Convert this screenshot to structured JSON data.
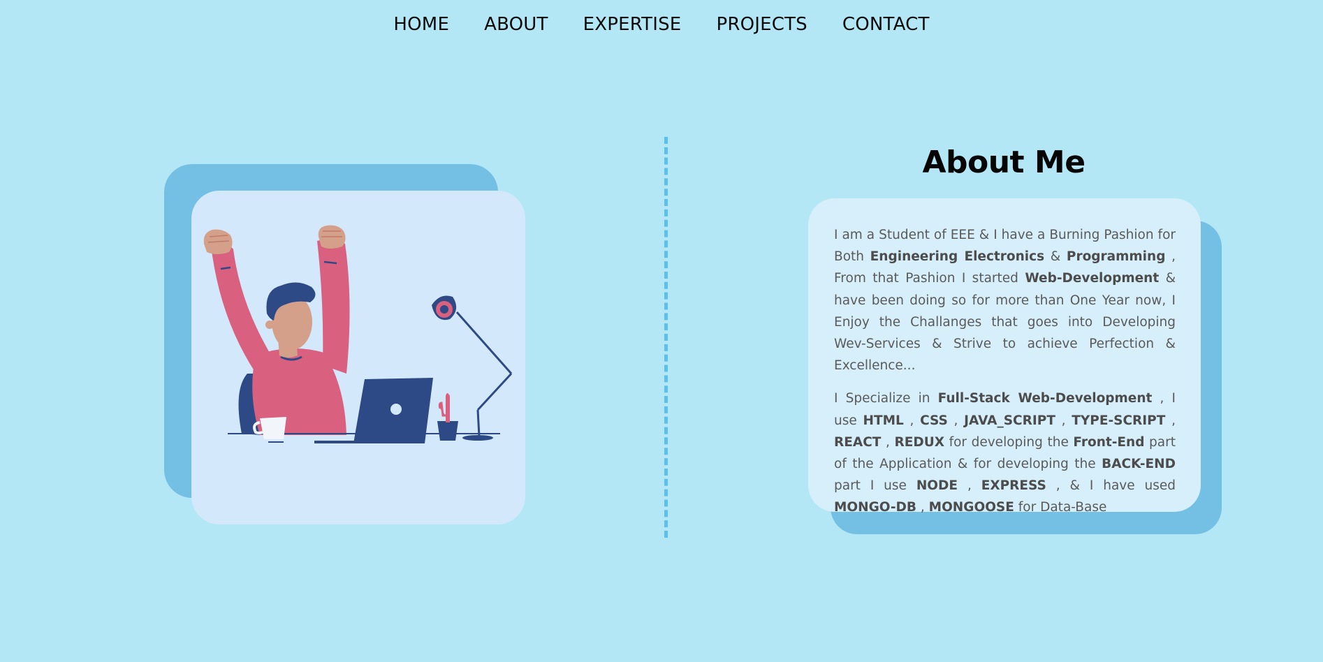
{
  "nav": {
    "items": [
      {
        "label": "HOME"
      },
      {
        "label": "ABOUT"
      },
      {
        "label": "EXPERTISE"
      },
      {
        "label": "PROJECTS"
      },
      {
        "label": "CONTACT"
      }
    ]
  },
  "about": {
    "title": "About Me",
    "p1": {
      "t1": "I am a Student of EEE & I have a Burning Pashion for Both ",
      "b1": "Engineering Electronics",
      "t2": " & ",
      "b2": "Programming",
      "t3": " , From that Pashion I started ",
      "b3": "Web-Development",
      "t4": " & have been doing so for more than One Year now, I Enjoy the Challanges that goes into Developing Wev-Services & Strive to achieve Perfection & Excellence..."
    },
    "p2": {
      "t1": "I Specialize in ",
      "b1": "Full-Stack Web-Development",
      "t2": " , I use ",
      "b2": "HTML",
      "t3": " , ",
      "b3": "CSS",
      "t4": " , ",
      "b4": "JAVA_SCRIPT",
      "t5": " , ",
      "b5": "TYPE-SCRIPT",
      "t6": " , ",
      "b6": "REACT",
      "t7": " , ",
      "b7": "REDUX",
      "t8": " for developing the ",
      "b8": "Front-End",
      "t9": " part of the Application & for developing the ",
      "b9": "BACK-END",
      "t10": " part I use ",
      "b10": "NODE",
      "t11": " , ",
      "b11": "EXPRESS",
      "t12": " , & I have used ",
      "b12": "MONGO-DB",
      "t13": " , ",
      "b13": "MONGOOSE",
      "t14": " for Data-Base"
    }
  },
  "colors": {
    "background": "#b3e7f6",
    "accent": "#74bfe4",
    "card": "#d6effa",
    "divider": "#5cc0ee",
    "sweater": "#d9607f",
    "navy": "#2d4a86"
  }
}
